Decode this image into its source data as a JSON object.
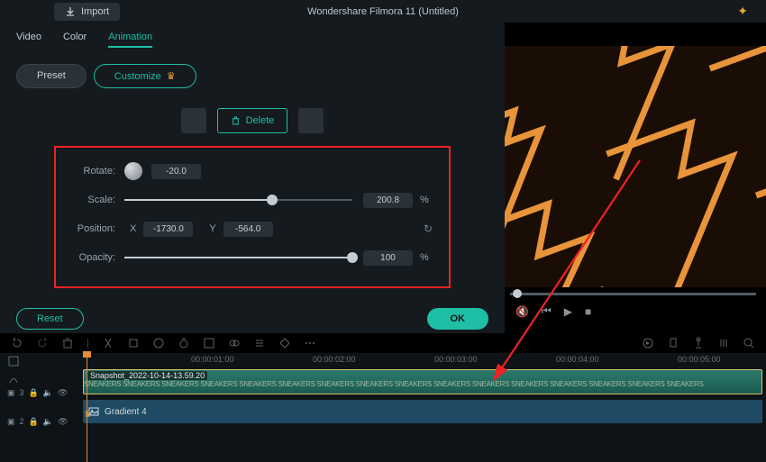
{
  "header": {
    "import": "Import",
    "title": "Wondershare Filmora 11 (Untitled)"
  },
  "tabs": {
    "video": "Video",
    "color": "Color",
    "animation": "Animation"
  },
  "presets": {
    "preset": "Preset",
    "customize": "Customize"
  },
  "actions": {
    "delete": "Delete",
    "reset": "Reset",
    "ok": "OK"
  },
  "controls": {
    "rotate": {
      "label": "Rotate:",
      "value": "-20.0"
    },
    "scale": {
      "label": "Scale:",
      "value": "200.8",
      "unit": "%"
    },
    "position": {
      "label": "Position:",
      "xlabel": "X",
      "x": "-1730.0",
      "ylabel": "Y",
      "y": "-564.0"
    },
    "opacity": {
      "label": "Opacity:",
      "value": "100",
      "unit": "%"
    }
  },
  "timeline": {
    "times": [
      "00:00:01:00",
      "00:00:02:00",
      "00:00:03:00",
      "00:00:04:00",
      "00:00:05:00"
    ],
    "clip1": "Snapshot_2022-10-14-13.59.20",
    "clip2": "Gradient 4",
    "track1": "3",
    "track2": "2"
  }
}
